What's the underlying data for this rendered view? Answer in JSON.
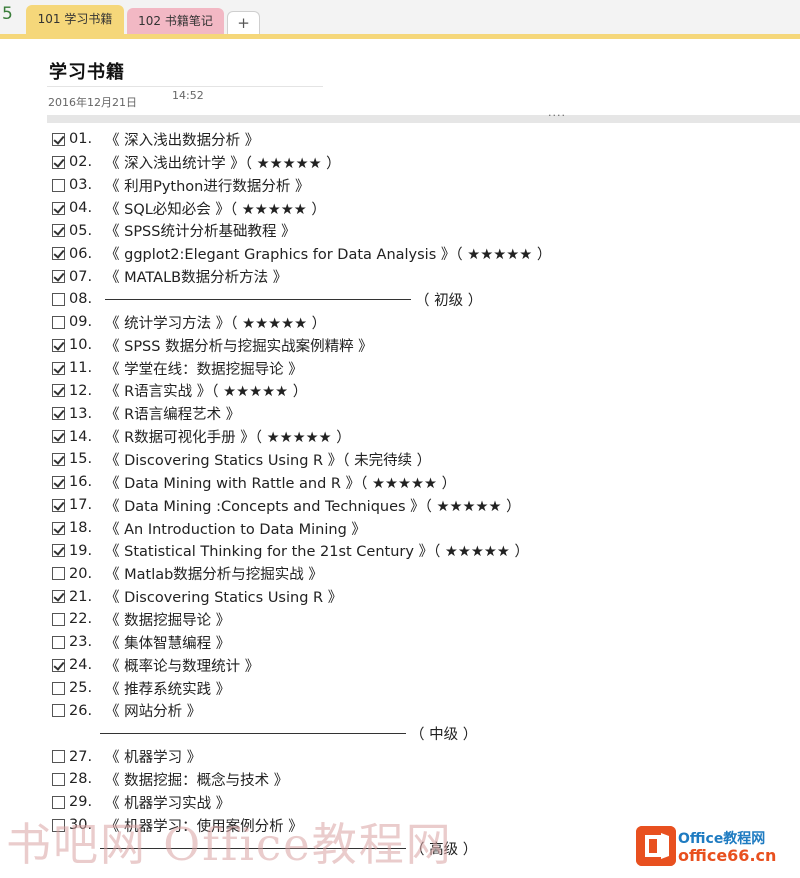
{
  "tabs": [
    {
      "label": "101 学习书籍",
      "active": true
    },
    {
      "label": "102 书籍笔记",
      "active": false
    }
  ],
  "tab_add_label": "+",
  "page": {
    "title": "学习书籍",
    "date": "2016年12月21日",
    "time": "14:52",
    "grip": "····"
  },
  "items": [
    {
      "num": "01.",
      "text": "《 深入浅出数据分析 》",
      "checked": true
    },
    {
      "num": "02.",
      "text": "《 深入浅出统计学 》（ ★★★★★ ）",
      "checked": true
    },
    {
      "num": "03.",
      "text": "《 利用Python进行数据分析 》",
      "checked": false
    },
    {
      "num": "04.",
      "text": "《 SQL必知必会 》（ ★★★★★ ）",
      "checked": true
    },
    {
      "num": "05.",
      "text": "《 SPSS统计分析基础教程 》",
      "checked": true
    },
    {
      "num": "06.",
      "text": "《 ggplot2:Elegant Graphics for Data Analysis 》（ ★★★★★ ）",
      "checked": true
    },
    {
      "num": "07.",
      "text": "《 MATALB数据分析方法 》",
      "checked": true
    },
    {
      "num": "08.",
      "text": "（ 初级 ）",
      "checked": false,
      "divider": true
    },
    {
      "num": "09.",
      "text": "《 统计学习方法 》（ ★★★★★ ）",
      "checked": false
    },
    {
      "num": "10.",
      "text": "《 SPSS 数据分析与挖掘实战案例精粹 》",
      "checked": true
    },
    {
      "num": "11.",
      "text": "《 学堂在线：数据挖掘导论 》",
      "checked": true
    },
    {
      "num": "12.",
      "text": "《 R语言实战 》（ ★★★★★ ）",
      "checked": true
    },
    {
      "num": "13.",
      "text": "《 R语言编程艺术 》",
      "checked": true
    },
    {
      "num": "14.",
      "text": "《 R数据可视化手册 》（ ★★★★★ ）",
      "checked": true
    },
    {
      "num": "15.",
      "text": "《 Discovering Statics Using R 》（ 未完待续 ）",
      "checked": true
    },
    {
      "num": "16.",
      "text": "《 Data Mining with Rattle and R 》（ ★★★★★ ）",
      "checked": true
    },
    {
      "num": "17.",
      "text": "《 Data Mining :Concepts and Techniques 》（ ★★★★★ ）",
      "checked": true
    },
    {
      "num": "18.",
      "text": "《 An Introduction to Data Mining 》",
      "checked": true
    },
    {
      "num": "19.",
      "text": "《 Statistical Thinking for the 21st Century 》（ ★★★★★ ）",
      "checked": true
    },
    {
      "num": "20.",
      "text": "《 Matlab数据分析与挖掘实战 》",
      "checked": false
    },
    {
      "num": "21.",
      "text": "《 Discovering Statics Using R 》",
      "checked": true
    },
    {
      "num": "22.",
      "text": "《 数据挖掘导论 》",
      "checked": false
    },
    {
      "num": "23.",
      "text": "《 集体智慧编程 》",
      "checked": false
    },
    {
      "num": "24.",
      "text": "《 概率论与数理统计 》",
      "checked": true
    },
    {
      "num": "25.",
      "text": "《 推荐系统实践 》",
      "checked": false
    },
    {
      "num": "26.",
      "text": "《 网站分析 》",
      "checked": false
    },
    {
      "num": "",
      "text": "（ 中级 ）",
      "checked": null,
      "divider": true
    },
    {
      "num": "27.",
      "text": "《 机器学习 》",
      "checked": false
    },
    {
      "num": "28.",
      "text": "《 数据挖掘：概念与技术 》",
      "checked": false
    },
    {
      "num": "29.",
      "text": "《 机器学习实战 》",
      "checked": false
    },
    {
      "num": "30.",
      "text": "《 机器学习：使用案例分析 》",
      "checked": false
    },
    {
      "num": "",
      "text": "（ 高级 ）",
      "checked": null,
      "divider": true
    }
  ],
  "watermark": {
    "text": "书吧网 Office教程网",
    "brand": "Office教程网",
    "site": "office66.cn",
    "logo_icon": "office-logo-icon"
  },
  "colors": {
    "tab_active": "#f5d77a",
    "tab_inactive": "#f2b8c4",
    "brand_orange": "#e8501f",
    "brand_blue": "#1e7bc1"
  }
}
